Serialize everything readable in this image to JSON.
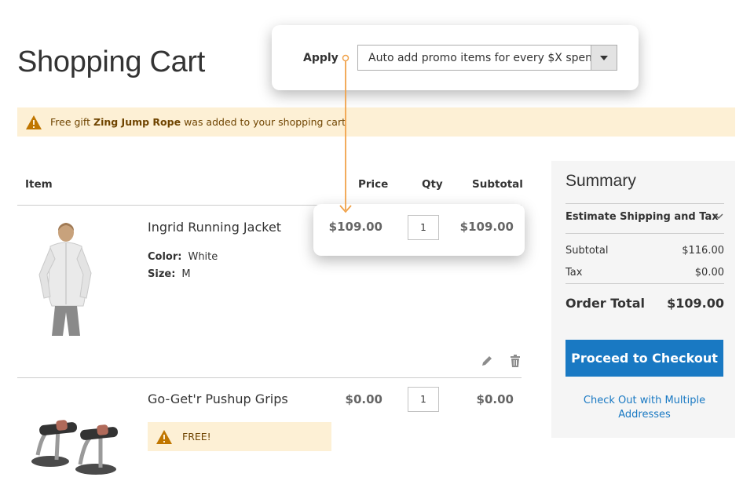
{
  "page": {
    "title": "Shopping Cart"
  },
  "notice": {
    "prefix": "Free gift",
    "item": "Zing Jump Rope",
    "suffix": "was added to your shopping cart"
  },
  "table": {
    "headers": {
      "item": "Item",
      "price": "Price",
      "qty": "Qty",
      "subtotal": "Subtotal"
    }
  },
  "items": [
    {
      "name": "Ingrid Running Jacket",
      "options": [
        {
          "label": "Color:",
          "value": "White"
        },
        {
          "label": "Size:",
          "value": "M"
        }
      ],
      "price": "$109.00",
      "qty": "1",
      "subtotal": "$109.00"
    },
    {
      "name": "Go-Get'r Pushup Grips",
      "price": "$0.00",
      "qty": "1",
      "subtotal": "$0.00",
      "free_label": "FREE!"
    }
  ],
  "summary": {
    "title": "Summary",
    "estimate_label": "Estimate Shipping and Tax",
    "subtotal_label": "Subtotal",
    "subtotal_value": "$116.00",
    "tax_label": "Tax",
    "tax_value": "$0.00",
    "order_total_label": "Order Total",
    "order_total_value": "$109.00",
    "checkout_label": "Proceed to Checkout",
    "multi_address_label": "Check Out with Multiple Addresses"
  },
  "callout": {
    "apply_label": "Apply",
    "select_value": "Auto add promo items for every $X spent"
  },
  "colors": {
    "accent": "#1979c3",
    "notice_bg": "#fdf0d5",
    "warning_icon": "#c07600",
    "connector": "#f0a24a"
  },
  "icons": [
    "warning-icon",
    "edit-pencil-icon",
    "trash-icon",
    "chevron-down-icon",
    "dropdown-arrow-icon"
  ]
}
